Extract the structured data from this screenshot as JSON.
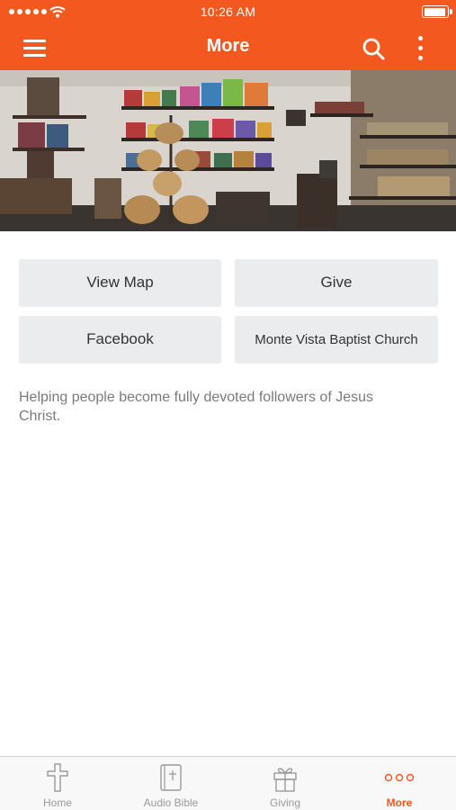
{
  "status_bar": {
    "time": "10:26 AM"
  },
  "nav": {
    "title": "More"
  },
  "buttons": {
    "view_map": "View Map",
    "give": "Give",
    "facebook": "Facebook",
    "church": "Monte Vista Baptist Church"
  },
  "description": "Helping people become fully devoted followers of Jesus Christ.",
  "tabs": [
    {
      "label": "Home",
      "icon": "cross-icon",
      "active": false
    },
    {
      "label": "Audio Bible",
      "icon": "bible-icon",
      "active": false
    },
    {
      "label": "Giving",
      "icon": "gift-icon",
      "active": false
    },
    {
      "label": "More",
      "icon": "more-dots-icon",
      "active": true
    }
  ],
  "colors": {
    "accent": "#f3581f",
    "button_bg": "#ebecee",
    "inactive_tab": "#9a9a9a"
  },
  "battery_level": 0.95
}
